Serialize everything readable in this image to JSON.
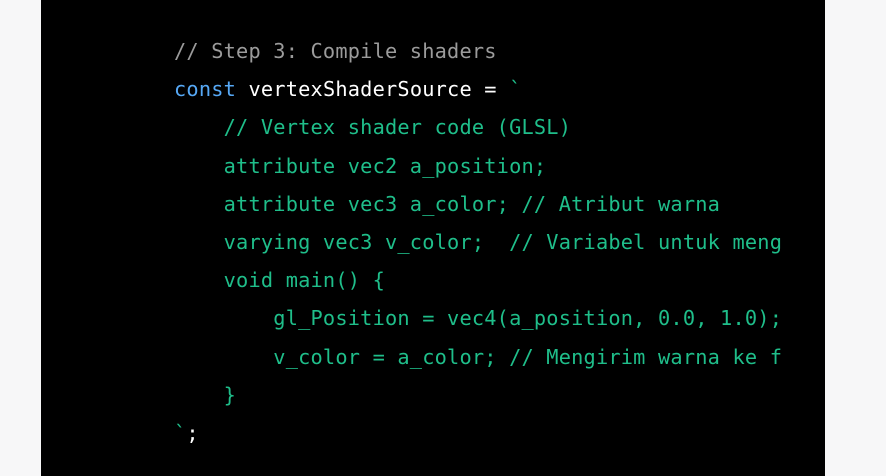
{
  "colors": {
    "page_background": "#f7f7f8",
    "code_background": "#000000",
    "comment": "#9b9b9b",
    "keyword": "#56a8f5",
    "identifier": "#ffffff",
    "template_string": "#1fbe8a"
  },
  "code": {
    "line1": {
      "comment": "// Step 3: Compile shaders"
    },
    "line2": {
      "keyword": "const",
      "ident": "vertexShaderSource",
      "op": " = ",
      "string": "`"
    },
    "line3": {
      "string": "    // Vertex shader code (GLSL)"
    },
    "line4": {
      "string": "    attribute vec2 a_position;"
    },
    "line5": {
      "string": "    attribute vec3 a_color; // Atribut warna"
    },
    "line6": {
      "string": "    varying vec3 v_color;  // Variabel untuk meng"
    },
    "line7": {
      "string": "    void main() {"
    },
    "line8": {
      "string": "        gl_Position = vec4(a_position, 0.0, 1.0);"
    },
    "line9": {
      "string": "        v_color = a_color; // Mengirim warna ke f"
    },
    "line10": {
      "string": "    }"
    },
    "line11": {
      "string": "`",
      "plain": ";"
    }
  }
}
